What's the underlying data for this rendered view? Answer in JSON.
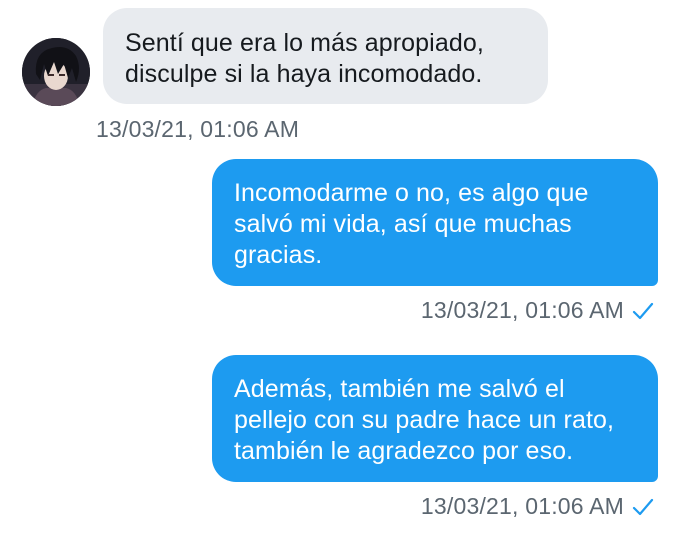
{
  "conversation": {
    "incoming": {
      "avatar_icon": "user-avatar",
      "lines": [
        "Sentí que era lo más apropiado,",
        "disculpe si la haya incomodado."
      ],
      "timestamp": "13/03/21, 01:06 AM"
    },
    "outgoing": [
      {
        "lines": [
          "Incomodarme o no, es algo que",
          "salvó mi vida, así que muchas",
          "gracias."
        ],
        "timestamp": "13/03/21, 01:06 AM",
        "status_icon": "check-icon"
      },
      {
        "lines": [
          "Además, también me salvó el",
          "pellejo con su padre hace un rato,",
          "también le agradezco por eso."
        ],
        "timestamp": "13/03/21, 01:06 AM",
        "status_icon": "check-icon"
      }
    ]
  },
  "colors": {
    "outgoing_bubble": "#1d9bf0",
    "incoming_bubble": "#e8ebef",
    "timestamp_text": "#5b6670",
    "check": "#1d9bf0"
  }
}
